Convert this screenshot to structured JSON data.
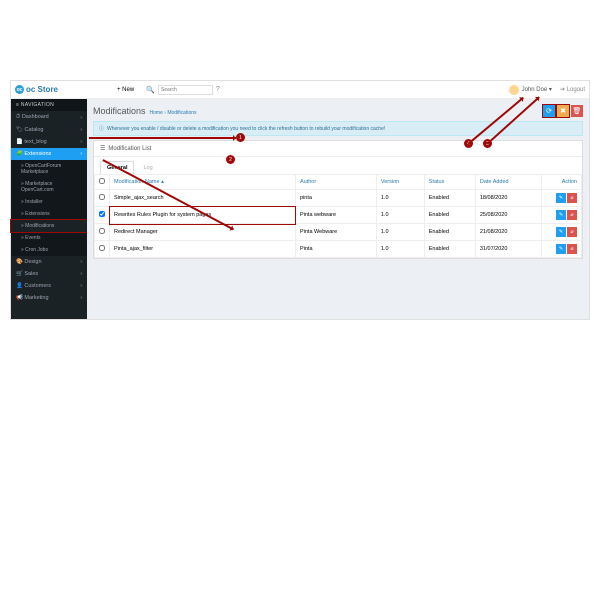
{
  "brand": {
    "name": "oc Store"
  },
  "topbar": {
    "new": "+ New",
    "search_ph": "Search",
    "user": "John Doe ▾",
    "logout": "➔ Logout"
  },
  "sidebar": {
    "header": "≡ NAVIGATION",
    "items": [
      {
        "icon": "⏱",
        "label": "Dashboard"
      },
      {
        "icon": "🏷",
        "label": "Catalog"
      },
      {
        "icon": "📄",
        "label": "text_blog"
      },
      {
        "icon": "🧩",
        "label": "Extensions"
      }
    ],
    "subitems": [
      {
        "label": "OpenCartForum Marketplace"
      },
      {
        "label": "Marketplace OpenCart.com"
      },
      {
        "label": "Installer"
      },
      {
        "label": "Extensions"
      },
      {
        "label": "Modifications"
      },
      {
        "label": "Events"
      },
      {
        "label": "Cron Jobs"
      }
    ],
    "items2": [
      {
        "icon": "🎨",
        "label": "Design"
      },
      {
        "icon": "🛒",
        "label": "Sales"
      },
      {
        "icon": "👤",
        "label": "Customers"
      },
      {
        "icon": "📢",
        "label": "Marketing"
      }
    ]
  },
  "page": {
    "title": "Modifications",
    "crumb_home": "Home",
    "crumb_sep": " › ",
    "crumb_cur": "Modifications",
    "alert": "Whenever you enable / disable or delete a modification you need to click the refresh button to rebuild your modification cache!",
    "panel_title": "Modification List",
    "tabs": {
      "general": "General",
      "log": "Log"
    },
    "cols": {
      "name": "Modification Name ▴",
      "author": "Author",
      "version": "Version",
      "status": "Status",
      "date": "Date Added",
      "action": "Action"
    },
    "rows": [
      {
        "name": "Simple_ajax_search",
        "author": "pinta",
        "version": "1.0",
        "status": "Enabled",
        "date": "18/08/2020"
      },
      {
        "name": "Rewrites Rules Plugin for system pages",
        "author": "Pinta webware",
        "version": "1.0",
        "status": "Enabled",
        "date": "25/08/2020",
        "hl": true,
        "checked": true
      },
      {
        "name": "Redirect Manager",
        "author": "Pinta Webware",
        "version": "1.0",
        "status": "Enabled",
        "date": "21/08/2020"
      },
      {
        "name": "Pinta_ajax_filter",
        "author": "Pinta",
        "version": "1.0",
        "status": "Enabled",
        "date": "31/07/2020"
      }
    ]
  },
  "annot": {
    "1": "1",
    "2": "2",
    "3": "3",
    "4": "4"
  }
}
